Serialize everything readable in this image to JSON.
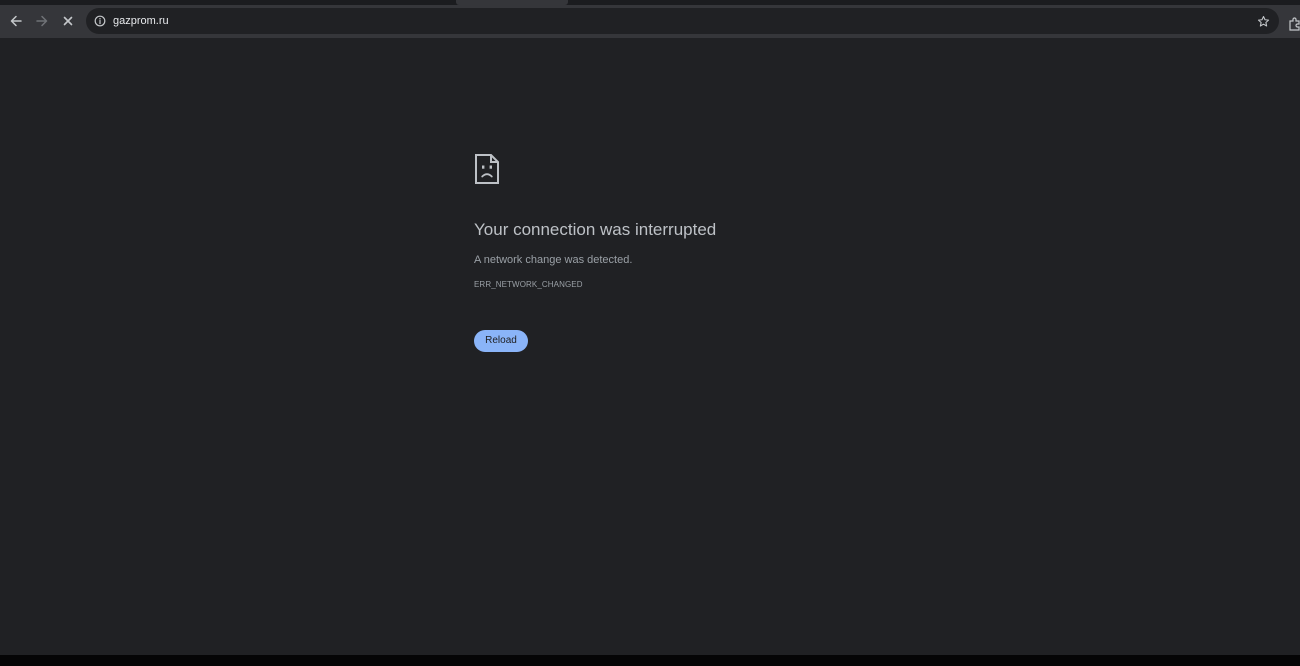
{
  "browser": {
    "url": "gazprom.ru",
    "icons": {
      "back": "arrow-left-icon",
      "forward": "arrow-right-icon",
      "stop": "close-icon",
      "site_info": "info-circle-icon",
      "bookmark": "star-icon",
      "extension": "puzzle-icon"
    }
  },
  "error_page": {
    "icon": "sad-document-icon",
    "title": "Your connection was interrupted",
    "description": "A network change was detected.",
    "error_code": "ERR_NETWORK_CHANGED",
    "reload_label": "Reload"
  },
  "colors": {
    "background": "#202124",
    "toolbar": "#35363a",
    "accent": "#8ab4f8",
    "title_text": "#bdc1c6",
    "secondary_text": "#9aa0a6"
  }
}
